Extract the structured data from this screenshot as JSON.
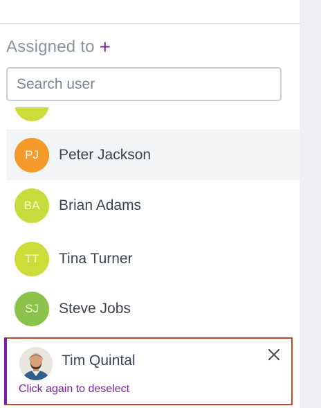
{
  "assigned_section": {
    "title": "Assigned to",
    "add_icon": "plus-icon",
    "accent_color": "#7b1fa2"
  },
  "search": {
    "placeholder": "Search user",
    "value": ""
  },
  "users": [
    {
      "initials": "PJ",
      "name": "Peter Jackson",
      "color": "#f39a2b",
      "hovered": true
    },
    {
      "initials": "BA",
      "name": "Brian Adams",
      "color": "#c6dc3d"
    },
    {
      "initials": "TT",
      "name": "Tina Turner",
      "color": "#cddc39"
    },
    {
      "initials": "SJ",
      "name": "Steve Jobs",
      "color": "#8bc34a"
    }
  ],
  "selected_user": {
    "name": "Tim Quintal",
    "avatar": "photo",
    "hint": "Click again to deselect",
    "close_icon": "close-icon",
    "border_color": "#c14a2a"
  }
}
